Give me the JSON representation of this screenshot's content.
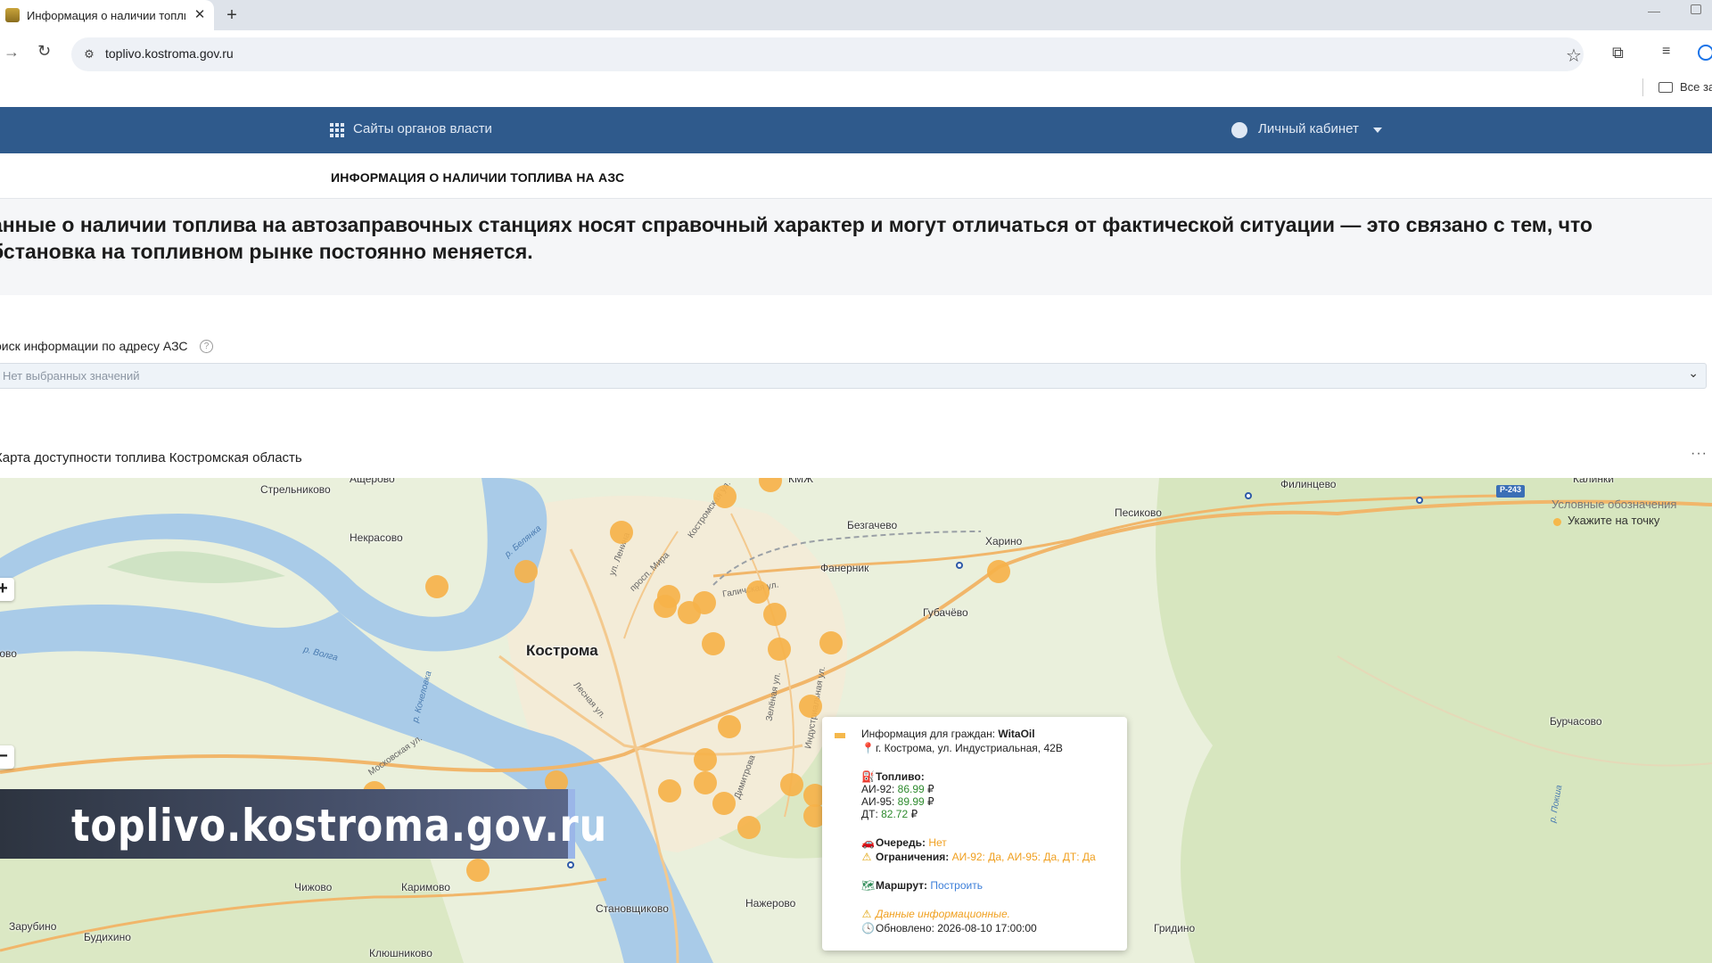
{
  "browser": {
    "tab_title": "Информация о наличии топли",
    "tab_close": "✕",
    "new_tab": "+",
    "url": "toplivo.kostroma.gov.ru",
    "all_bookmarks": "Все за"
  },
  "header": {
    "gov_sites": "Сайты органов власти",
    "cabinet": "Личный кабинет",
    "page_title": "ИНФОРМАЦИЯ О НАЛИЧИИ ТОПЛИВА НА АЗС"
  },
  "notice": {
    "line1": "анные о наличии топлива на автозаправочных станциях носят справочный характер и могут отличаться от фактической ситуации — это связано с тем, что",
    "line2": "бстановка на топливном рынке постоянно меняется."
  },
  "search": {
    "label": "оиск информации по адресу АЗС",
    "help": "?",
    "placeholder": "Нет выбранных значений"
  },
  "map": {
    "title": "Карта доступности топлива Костромская область",
    "more": "···",
    "city": "Кострома",
    "zoom_in": "+",
    "zoom_out": "−",
    "places": [
      "Стрельниково",
      "Некрасово",
      "Безгачево",
      "Фанерник",
      "Харино",
      "Губачёво",
      "Песиково",
      "Филинцево",
      "Калинки",
      "Бурчасово",
      "Чижово",
      "Каримово",
      "Становщиково",
      "Нажерово",
      "Гридино",
      "Зарубино",
      "Будихино",
      "Клюшниково",
      "ково",
      "Ащерово",
      "КМЖ"
    ],
    "streets": [
      "р. Белянка",
      "ул. Ленина",
      "Костромская ул.",
      "просп. Мира",
      "Галичская ул.",
      "Зелёная ул.",
      "Индустриальная ул.",
      "р. Волга",
      "Лесная ул.",
      "Московская ул.",
      "Димитрова",
      "р. Кочеловка",
      "Р-243",
      "р. Покша"
    ],
    "legend": {
      "title": "Условные обозначения",
      "item": "Укажите на точку"
    },
    "popup": {
      "info_label": "Информация для граждан: ",
      "station_name": "WitaOil",
      "address": "г. Кострома, ул. Индустриальная, 42В",
      "fuel_label": "Топливо:",
      "ai92_label": "АИ-92: ",
      "ai92_price": "86.99",
      "ai95_label": "АИ-95: ",
      "ai95_price": "89.99",
      "dt_label": "ДТ: ",
      "dt_price": "82.72",
      "currency": "₽",
      "queue_label": "Очередь: ",
      "queue_value": "Нет",
      "limits_label": "Ограничения: ",
      "limits_value": "АИ-92: Да, АИ-95: Да, ДТ: Да",
      "route_label": "Маршрут: ",
      "route_link": "Построить",
      "disclaimer": "Данные информационные.",
      "updated": "Обновлено: 2026-08-10 17:00:00"
    }
  },
  "banner": {
    "text": "toplivo.kostroma.gov.ru"
  },
  "colors": {
    "gov_bar": "#2f5a8c",
    "station": "#f6b24a",
    "river": "#a9cbe8",
    "price_green": "#2e8b2e",
    "warn_orange": "#f0a020",
    "link_blue": "#3d7fd9"
  }
}
